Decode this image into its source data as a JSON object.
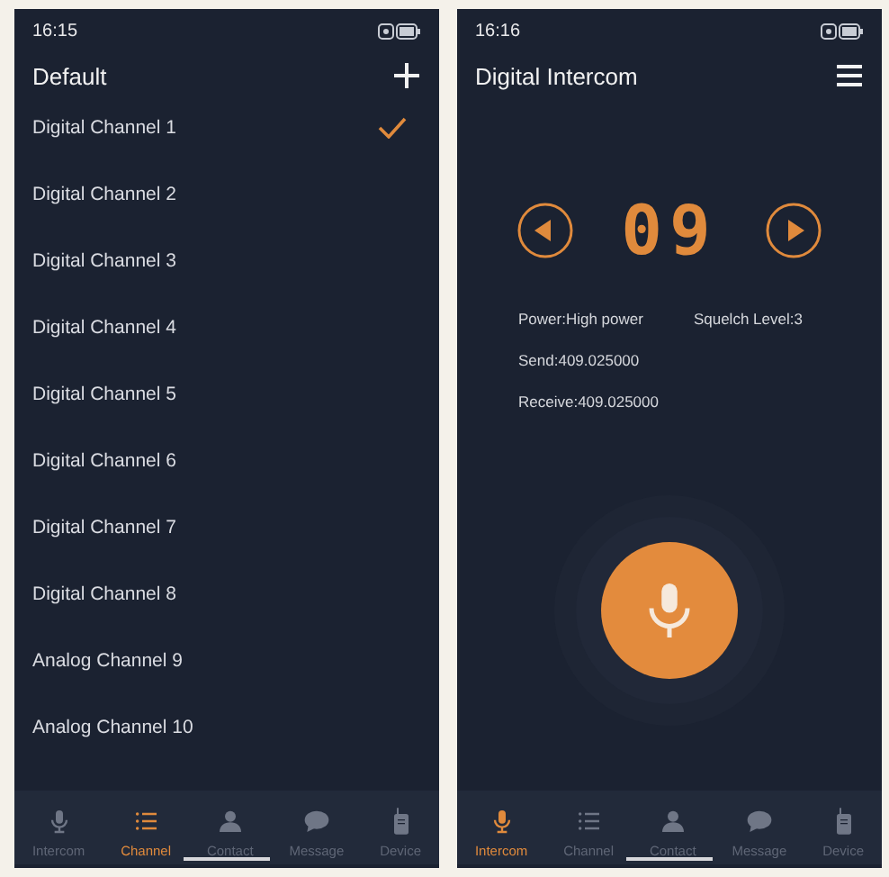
{
  "phones": [
    {
      "kind": "channel-list",
      "status_time": "16:15",
      "title": "Default",
      "channels": [
        {
          "name": "Digital Channel 1",
          "selected": true
        },
        {
          "name": "Digital Channel 2",
          "selected": false
        },
        {
          "name": "Digital Channel 3",
          "selected": false
        },
        {
          "name": "Digital Channel 4",
          "selected": false
        },
        {
          "name": "Digital Channel 5",
          "selected": false
        },
        {
          "name": "Digital Channel 6",
          "selected": false
        },
        {
          "name": "Digital Channel 7",
          "selected": false
        },
        {
          "name": "Digital Channel 8",
          "selected": false
        },
        {
          "name": "Analog Channel 9",
          "selected": false
        },
        {
          "name": "Analog Channel 10",
          "selected": false
        }
      ],
      "nav": [
        {
          "kind": "mic",
          "label": "Intercom",
          "selected": false
        },
        {
          "kind": "list",
          "label": "Channel",
          "selected": true
        },
        {
          "kind": "person",
          "label": "Contact",
          "selected": false
        },
        {
          "kind": "chat",
          "label": "Message",
          "selected": false
        },
        {
          "kind": "radio",
          "label": "Device",
          "selected": false
        }
      ]
    },
    {
      "kind": "intercom",
      "status_time": "16:16",
      "title": "Digital Intercom",
      "channel_number": "09",
      "info": [
        [
          "Power:High power",
          "Squelch Level:3"
        ],
        [
          "Send:409.025000"
        ],
        [
          "Receive:409.025000"
        ]
      ],
      "nav": [
        {
          "kind": "mic",
          "label": "Intercom",
          "selected": true
        },
        {
          "kind": "list",
          "label": "Channel",
          "selected": false
        },
        {
          "kind": "person",
          "label": "Contact",
          "selected": false
        },
        {
          "kind": "chat",
          "label": "Message",
          "selected": false
        },
        {
          "kind": "radio",
          "label": "Device",
          "selected": false
        }
      ]
    }
  ]
}
